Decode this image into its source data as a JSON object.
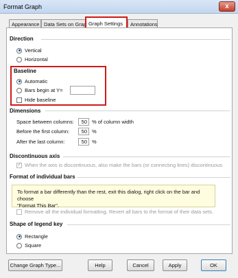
{
  "window": {
    "title": "Format Graph",
    "close_label": "x"
  },
  "tabs": [
    "Appearance",
    "Data Sets on Graph",
    "Graph Settings",
    "Annotations"
  ],
  "direction": {
    "title": "Direction",
    "options": [
      "Vertical",
      "Horizontal"
    ],
    "selected": "Vertical"
  },
  "baseline": {
    "title": "Baseline",
    "automatic_label": "Automatic",
    "bars_begin_label": "Bars begin at Y=",
    "bars_begin_value": "",
    "hide_label": "Hide baseline",
    "selected": "Automatic",
    "hide_checked": false
  },
  "dimensions": {
    "title": "Dimensions",
    "rows": [
      {
        "label": "Space between columns:",
        "value": "50",
        "unit": "% of column width"
      },
      {
        "label": "Before the first column:",
        "value": "50",
        "unit": "%"
      },
      {
        "label": "After the last column:",
        "value": "50",
        "unit": "%"
      }
    ]
  },
  "discontinuous": {
    "title": "Discontinuous axis",
    "option_label": "When the axis is discontinuous, also make the bars (or connecting lines) discontinuous",
    "checked": true
  },
  "individual": {
    "title": "Format of individual bars",
    "note_line1": "To format a bar differently than the rest, exit this dialog, right click on the bar and choose",
    "note_line2": "\"Format This Bar\".",
    "remove_label": "Remove all the individual formatting. Revert all bars to the format of their data sets."
  },
  "legend_shape": {
    "title": "Shape of legend key",
    "options": [
      "Rectangle",
      "Square"
    ],
    "selected": "Rectangle"
  },
  "buttons": {
    "change_graph_type": "Change Graph Type...",
    "help": "Help",
    "cancel": "Cancel",
    "apply": "Apply",
    "ok": "OK"
  },
  "colors": {
    "highlight": "#d01818",
    "titlebar": "#c8daf0"
  }
}
